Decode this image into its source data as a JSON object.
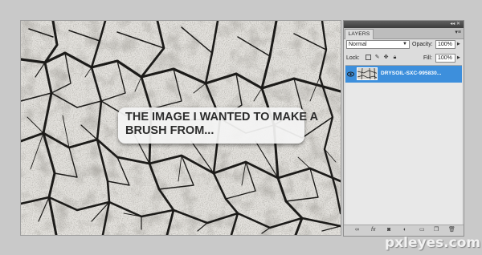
{
  "canvas": {
    "callout_line1": "THE IMAGE I WANTED TO MAKE A",
    "callout_line2": "BRUSH FROM..."
  },
  "layers_panel": {
    "topbar_controls": "◂◂ ✕",
    "tab_label": "LAYERS",
    "menu_icon": "▾≡",
    "blend_mode": "Normal",
    "opacity_label": "Opacity:",
    "opacity_value": "100%",
    "lock_label": "Lock:",
    "fill_label": "Fill:",
    "fill_value": "100%",
    "layers": [
      {
        "name": "DRYSOIL-SXC-995830...",
        "visible": true,
        "selected": true
      }
    ],
    "selection_color": "#3d8fdc"
  },
  "watermark": "pxleyes.com",
  "icons": {
    "lock_icons": [
      "lock-transparent-icon",
      "lock-brush-icon",
      "lock-move-icon",
      "lock-all-icon"
    ],
    "bottom_icons": [
      "link-layers-icon",
      "fx-icon",
      "layer-mask-icon",
      "adjustment-layer-icon",
      "new-group-icon",
      "new-layer-icon",
      "trash-icon"
    ]
  }
}
